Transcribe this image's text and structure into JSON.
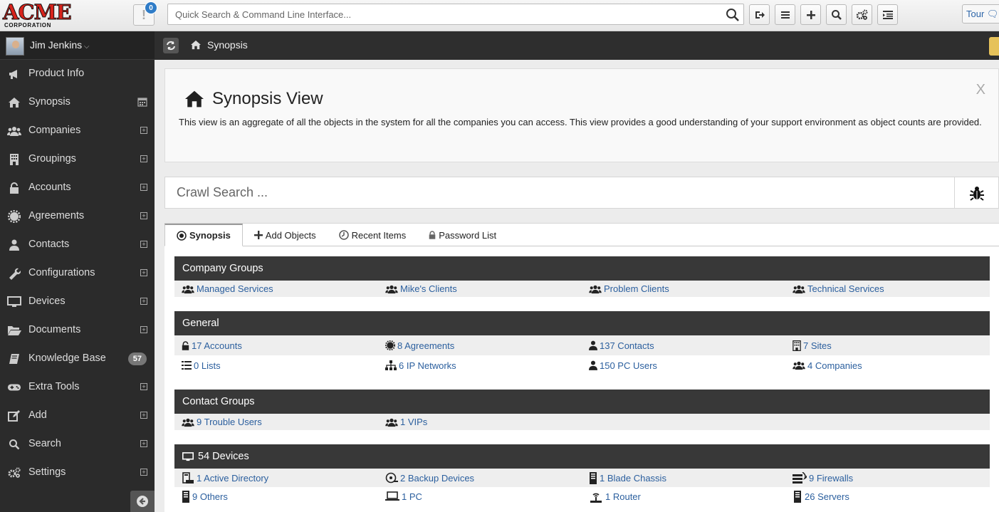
{
  "brand": {
    "logo_text": "ACME",
    "logo_sub": "CORPORATION"
  },
  "topbar": {
    "notification_count": "0",
    "search_placeholder": "Quick Search & Command Line Interface...",
    "tour_label": "Tour"
  },
  "user": {
    "name": "Jim Jenkins"
  },
  "sidebar": {
    "items": [
      {
        "label": "Product Info",
        "icon": "megaphone-icon"
      },
      {
        "label": "Synopsis",
        "icon": "home-icon"
      },
      {
        "label": "Companies",
        "icon": "users-icon"
      },
      {
        "label": "Groupings",
        "icon": "building-icon"
      },
      {
        "label": "Accounts",
        "icon": "lock-icon"
      },
      {
        "label": "Agreements",
        "icon": "cog-badge-icon"
      },
      {
        "label": "Contacts",
        "icon": "user-icon"
      },
      {
        "label": "Configurations",
        "icon": "wrench-icon"
      },
      {
        "label": "Devices",
        "icon": "monitor-icon"
      },
      {
        "label": "Documents",
        "icon": "folder-icon"
      },
      {
        "label": "Knowledge Base",
        "icon": "book-icon",
        "badge": "57"
      },
      {
        "label": "Extra Tools",
        "icon": "gamepad-icon"
      },
      {
        "label": "Add",
        "icon": "edit-icon"
      },
      {
        "label": "Search",
        "icon": "search-icon"
      },
      {
        "label": "Settings",
        "icon": "cogs-icon"
      }
    ]
  },
  "breadcrumb": {
    "label": "Synopsis"
  },
  "view": {
    "title": "Synopsis View",
    "description": "This view is an aggregate of all the objects in the system for all the companies you can access. This view provides a good understanding of your support environment as object counts are provided.",
    "close_label": "X"
  },
  "crawl": {
    "placeholder": "Crawl Search ..."
  },
  "tabs": [
    {
      "label": "Synopsis",
      "active": true
    },
    {
      "label": "Add Objects"
    },
    {
      "label": "Recent Items"
    },
    {
      "label": "Password List"
    }
  ],
  "sections": {
    "company_groups": {
      "title": "Company Groups",
      "items": [
        "Managed Services",
        "Mike's Clients",
        "Problem Clients",
        "Technical Services"
      ]
    },
    "general": {
      "title": "General",
      "row1": [
        "17 Accounts",
        "8 Agreements",
        "137 Contacts",
        "7 Sites"
      ],
      "row2": [
        "0 Lists",
        "6 IP Networks",
        "150 PC Users",
        "4 Companies"
      ]
    },
    "contact_groups": {
      "title": "Contact Groups",
      "items": [
        "9 Trouble Users",
        "1 VIPs"
      ]
    },
    "devices": {
      "title": "54 Devices",
      "row1": [
        "1 Active Directory",
        "2 Backup Devices",
        "1 Blade Chassis",
        "9 Firewalls"
      ],
      "row2": [
        "9 Others",
        "1 PC",
        "1 Router",
        "26 Servers"
      ]
    }
  }
}
